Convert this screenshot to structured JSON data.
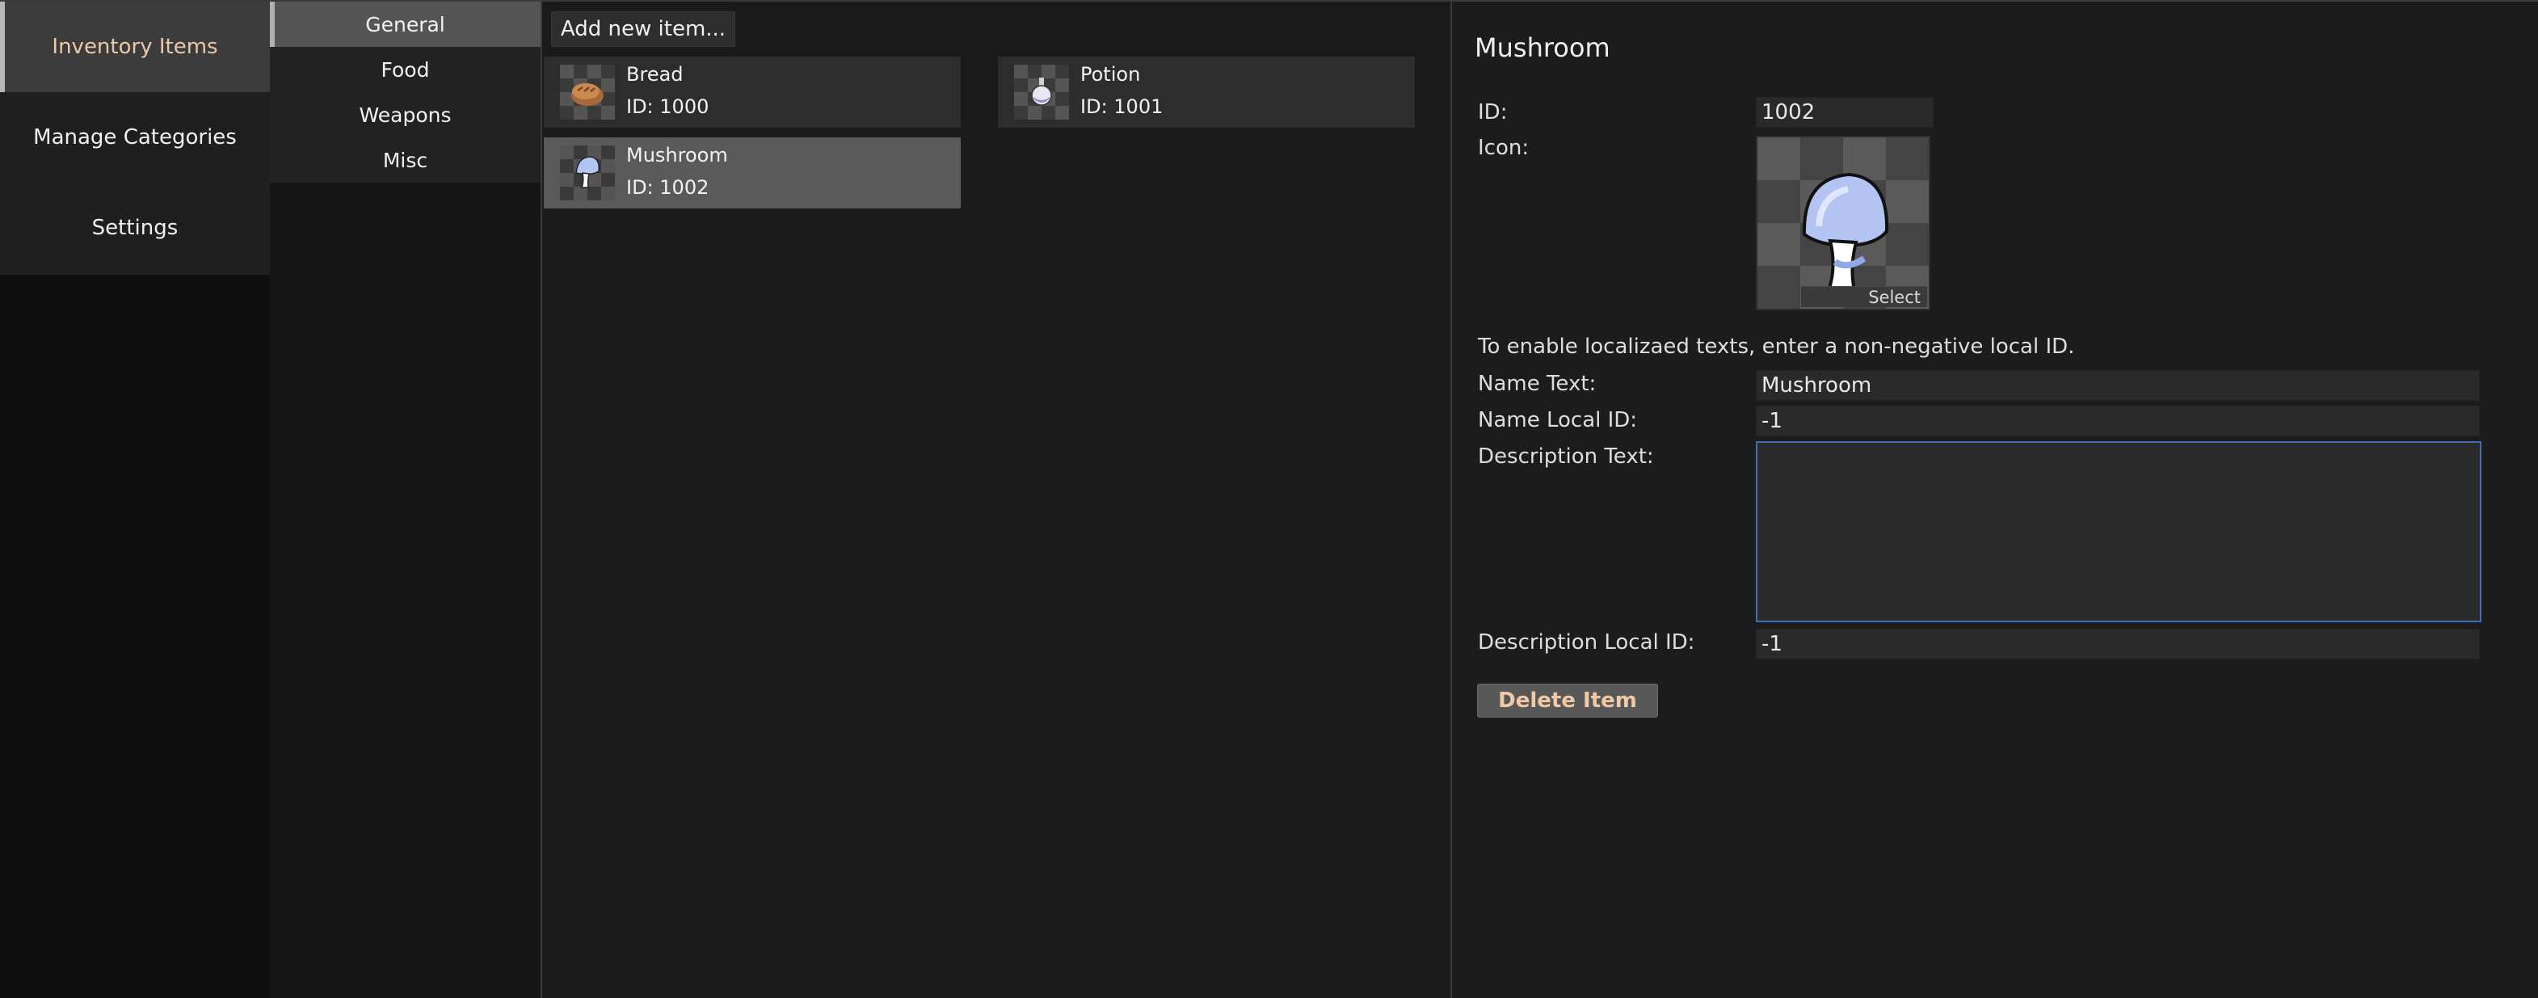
{
  "nav": {
    "items": [
      {
        "label": "Inventory Items",
        "active": true
      },
      {
        "label": "Manage Categories",
        "active": false
      },
      {
        "label": "Settings",
        "active": false
      }
    ]
  },
  "categories": {
    "items": [
      {
        "label": "General",
        "active": true
      },
      {
        "label": "Food",
        "active": false
      },
      {
        "label": "Weapons",
        "active": false
      },
      {
        "label": "Misc",
        "active": false
      }
    ]
  },
  "items": {
    "add_label": "Add new item...",
    "cards": [
      {
        "name": "Bread",
        "id_text": "ID: 1000",
        "icon": "bread-icon",
        "selected": false
      },
      {
        "name": "Potion",
        "id_text": "ID: 1001",
        "icon": "potion-icon",
        "selected": false
      },
      {
        "name": "Mushroom",
        "id_text": "ID: 1002",
        "icon": "mushroom-icon",
        "selected": true
      }
    ]
  },
  "detail": {
    "title": "Mushroom",
    "id_label": "ID:",
    "id_value": "1002",
    "icon_label": "Icon:",
    "icon_name": "mushroom-icon",
    "icon_select": "Select",
    "hint": "To enable localizaed texts, enter a non-negative local ID.",
    "name_text_label": "Name Text:",
    "name_text_value": "Mushroom",
    "name_local_label": "Name Local ID:",
    "name_local_value": "-1",
    "desc_text_label": "Description Text:",
    "desc_text_value": "",
    "desc_local_label": "Description Local ID:",
    "desc_local_value": "-1",
    "delete_label": "Delete Item"
  },
  "colors": {
    "accent_text": "#e9c9a8",
    "focus_border": "#3f6fb0",
    "selected_card": "#5a5a5a"
  }
}
